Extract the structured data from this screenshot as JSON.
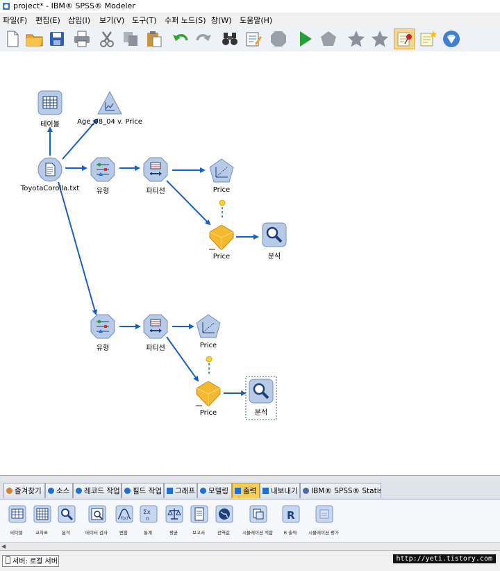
{
  "window": {
    "title": "project* - IBM® SPSS® Modeler"
  },
  "menu": [
    {
      "id": "file",
      "label": "파일(F)"
    },
    {
      "id": "edit",
      "label": "편집(E)"
    },
    {
      "id": "insert",
      "label": "삽입(I)"
    },
    {
      "id": "view",
      "label": "보기(V)"
    },
    {
      "id": "tools",
      "label": "도구(T)"
    },
    {
      "id": "supernode",
      "label": "수퍼 노드(S)"
    },
    {
      "id": "window",
      "label": "창(W)"
    },
    {
      "id": "help",
      "label": "도움말(H)"
    }
  ],
  "toolbar": [
    {
      "id": "new",
      "icon": "new-file-icon"
    },
    {
      "id": "open",
      "icon": "open-folder-icon"
    },
    {
      "id": "save",
      "icon": "save-icon"
    },
    {
      "id": "print",
      "icon": "print-icon"
    },
    {
      "id": "cut",
      "icon": "cut-icon"
    },
    {
      "id": "copy",
      "icon": "copy-icon"
    },
    {
      "id": "paste",
      "icon": "paste-icon"
    },
    {
      "id": "undo",
      "icon": "undo-icon"
    },
    {
      "id": "redo",
      "icon": "redo-icon"
    },
    {
      "id": "find",
      "icon": "binoculars-icon"
    },
    {
      "id": "edit-stream",
      "icon": "edit-stream-icon"
    },
    {
      "id": "stop",
      "icon": "stop-icon"
    },
    {
      "id": "run",
      "icon": "run-icon"
    },
    {
      "id": "run-selection",
      "icon": "run-selection-icon"
    },
    {
      "id": "zoom-in",
      "icon": "star-icon"
    },
    {
      "id": "zoom-out",
      "icon": "star-icon-2"
    },
    {
      "id": "annotation",
      "icon": "annotation-pin-icon"
    },
    {
      "id": "comment",
      "icon": "comment-icon"
    },
    {
      "id": "global",
      "icon": "gem-icon"
    }
  ],
  "nodes": [
    {
      "id": "table",
      "label": "테이블",
      "icon": "table-node-icon"
    },
    {
      "id": "plot",
      "label": "Age_08_04 v. Price",
      "icon": "plot-node-icon"
    },
    {
      "id": "source",
      "label": "ToyotaCorolla.txt",
      "icon": "source-file-icon"
    },
    {
      "id": "type1",
      "label": "유형",
      "icon": "type-node-icon"
    },
    {
      "id": "partition1",
      "label": "파티션",
      "icon": "partition-node-icon"
    },
    {
      "id": "model1",
      "label": "Price",
      "icon": "regression-model-icon"
    },
    {
      "id": "nugget1",
      "label": "Price",
      "icon": "model-nugget-icon"
    },
    {
      "id": "analysis1",
      "label": "분석",
      "icon": "analysis-node-icon"
    },
    {
      "id": "type2",
      "label": "유형",
      "icon": "type-node-icon"
    },
    {
      "id": "partition2",
      "label": "파티션",
      "icon": "partition-node-icon"
    },
    {
      "id": "model2",
      "label": "Price",
      "icon": "regression-model-icon"
    },
    {
      "id": "nugget2",
      "label": "Price",
      "icon": "model-nugget-icon"
    },
    {
      "id": "analysis2",
      "label": "분석",
      "icon": "analysis-node-icon"
    }
  ],
  "palette_tabs": [
    {
      "id": "favorites",
      "label": "즐겨찾기"
    },
    {
      "id": "sources",
      "label": "소스"
    },
    {
      "id": "record-ops",
      "label": "레코드 작업"
    },
    {
      "id": "field-ops",
      "label": "필드 작업"
    },
    {
      "id": "graphs",
      "label": "그래프"
    },
    {
      "id": "modeling",
      "label": "모델링"
    },
    {
      "id": "output",
      "label": "출력"
    },
    {
      "id": "export",
      "label": "내보내기"
    },
    {
      "id": "spss-statistics",
      "label": "IBM® SPSS® Statistics"
    }
  ],
  "active_palette_tab": "출력",
  "palette_items": [
    {
      "id": "table",
      "label": "테이블"
    },
    {
      "id": "matrix",
      "label": "교차표"
    },
    {
      "id": "analysis",
      "label": "분석"
    },
    {
      "id": "data-audit",
      "label": "데이터 검사"
    },
    {
      "id": "transform",
      "label": "변환"
    },
    {
      "id": "statistics",
      "label": "통계"
    },
    {
      "id": "means",
      "label": "평균"
    },
    {
      "id": "report",
      "label": "보고서"
    },
    {
      "id": "global-values",
      "label": "전역값"
    },
    {
      "id": "sim-fitting",
      "label": "시뮬레이션 적합"
    },
    {
      "id": "r-output",
      "label": "R 출력"
    },
    {
      "id": "sim-eval",
      "label": "시뮬레이션 평가"
    }
  ],
  "status": {
    "server": "서버: 로컬 서버"
  },
  "watermark": "http://yeti.tistory.com",
  "colors": {
    "accent": "#1f6fd6",
    "active_tab": "#f7cf55",
    "link": "#1a5fc4"
  }
}
